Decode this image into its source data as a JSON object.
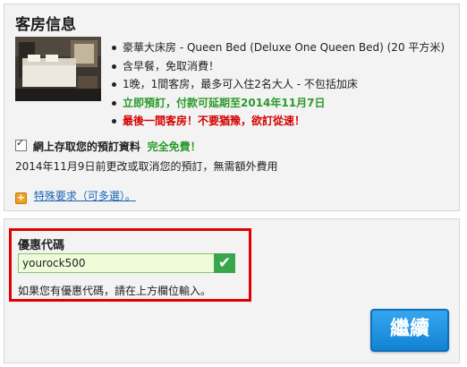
{
  "room": {
    "title": "客房信息",
    "photo_icon": "hotel-room-photo",
    "features": [
      "豪華大床房 - Queen Bed (Deluxe One Queen Bed) (20 平方米)",
      "含早餐，免取消費！",
      "1晚，1間客房，最多可入住2名大人 - 不包括加床",
      "立即預訂，付款可延期至2014年11月7日",
      "最後一間客房！不要猶豫，欲訂從速！"
    ]
  },
  "save_details": {
    "checked": true,
    "label": "網上存取您的預訂資料",
    "free_text": "完全免費！"
  },
  "cancel_note": "2014年11月9日前更改或取消您的預訂，無需額外費用",
  "special_requests": {
    "icon": "plus-icon",
    "label": "特殊要求（可多選）。"
  },
  "promo": {
    "label": "優惠代碼",
    "value": "yourock500",
    "valid_icon": "checkmark-icon",
    "hint": "如果您有優惠代碼，請在上方欄位輸入。"
  },
  "continue_label": "繼續",
  "colors": {
    "green": "#2a9a2a",
    "red": "#d40000",
    "link": "#1a63b5",
    "highlight_border": "#e00000",
    "button_blue": "#1b8fe0"
  }
}
